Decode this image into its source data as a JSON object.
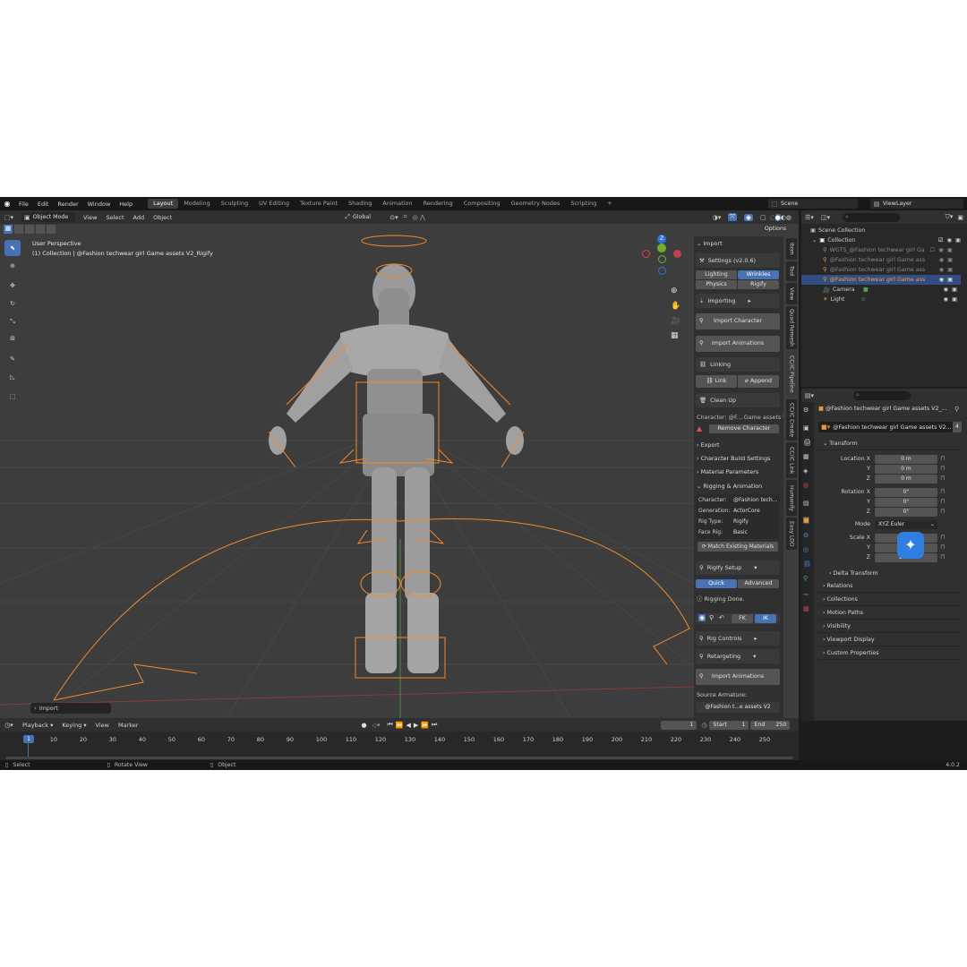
{
  "app": {
    "version": "4.0.2"
  },
  "colors": {
    "accent": "#4772b3",
    "selection": "#f08c2a",
    "bg": "#3d3d3d",
    "warn": "#e05050"
  },
  "topbar": {
    "menus": [
      "File",
      "Edit",
      "Render",
      "Window",
      "Help"
    ],
    "workspaces": [
      "Layout",
      "Modeling",
      "Sculpting",
      "UV Editing",
      "Texture Paint",
      "Shading",
      "Animation",
      "Rendering",
      "Compositing",
      "Geometry Nodes",
      "Scripting"
    ],
    "active_workspace": "Layout",
    "add_tab": "+",
    "scene": "Scene",
    "view_layer": "ViewLayer"
  },
  "viewport": {
    "mode": "Object Mode",
    "menus": [
      "View",
      "Select",
      "Add",
      "Object"
    ],
    "orientation": "Global",
    "options": "Options",
    "info_line1": "User Perspective",
    "info_line2": "(1) Collection | @Fashion techwear girl Game assets V2_Rigify",
    "gizmo_z": "Z",
    "last_op": "Import"
  },
  "npanel": {
    "import_header": "Import",
    "settings_label": "Settings  (v2.0.6)",
    "settings_tabs": [
      "Lighting",
      "Wrinkles",
      "Physics",
      "Rigify"
    ],
    "active_settings_tab": "Wrinkles",
    "importing": "Importing",
    "import_character": "Import Character",
    "import_animations": "Import Animations",
    "linking": "Linking",
    "link": "Link",
    "append": "Append",
    "clean_up": "Clean Up",
    "character_label": "Character: @F....Game assets V2",
    "remove_character": "Remove Character",
    "export": "Export",
    "character_build": "Character Build Settings",
    "material_params": "Material Parameters",
    "rigging_anim": "Rigging & Animation",
    "info": [
      {
        "k": "Character:",
        "v": "@Fashion tech..."
      },
      {
        "k": "Generation:",
        "v": "ActorCore"
      },
      {
        "k": "Rig Type:",
        "v": "Rigify"
      },
      {
        "k": "Face Rig:",
        "v": "Basic"
      }
    ],
    "match_materials": "Match Existing Materials",
    "rigify_setup": "Rigify Setup",
    "quick": "Quick",
    "advanced": "Advanced",
    "rigging_done": "Rigging Done.",
    "fk": "FK",
    "ik": "IK",
    "rig_controls": "Rig Controls",
    "retargeting": "Retargeting",
    "import_animations2": "Import Animations",
    "source_armature": "Source Armature:",
    "source_value": "@Fashion t...e assets V2"
  },
  "vtabs": [
    "Item",
    "Tool",
    "View",
    "Quad Remesh",
    "CC/iC Pipeline",
    "CC/iC Create",
    "CC/iC Link",
    "Humanify",
    "Easy LOD"
  ],
  "outliner": {
    "scene_collection": "Scene Collection",
    "collection": "Collection",
    "items": [
      {
        "label": "WGTS_@Fashion techwear girl Ga",
        "selected": false
      },
      {
        "label": "@Fashion techwear girl Game ass",
        "selected": false
      },
      {
        "label": "@Fashion techwear girl Game ass",
        "selected": false
      },
      {
        "label": "@Fashion techwear girl Game ass",
        "selected": true
      },
      {
        "label": "Camera",
        "selected": false
      },
      {
        "label": "Light",
        "selected": false
      }
    ]
  },
  "properties": {
    "object_path": "@Fashion techwear girl Game assets V2_...",
    "object_name": "@Fashion techwear girl Game assets V2...",
    "user_count": "4",
    "transform": "Transform",
    "location": {
      "labels": [
        "Location X",
        "Y",
        "Z"
      ],
      "values": [
        "0 m",
        "0 m",
        "0 m"
      ]
    },
    "rotation": {
      "labels": [
        "Rotation X",
        "Y",
        "Z"
      ],
      "values": [
        "0°",
        "0°",
        "0°"
      ]
    },
    "mode_label": "Mode",
    "mode_value": "XYZ Euler",
    "scale": {
      "labels": [
        "Scale X",
        "Y",
        "Z"
      ],
      "values": [
        "1.000",
        "1.000",
        "1.000"
      ]
    },
    "delta": "Delta Transform",
    "panels": [
      "Relations",
      "Collections",
      "Motion Paths",
      "Visibility",
      "Viewport Display",
      "Custom Properties"
    ]
  },
  "timeline": {
    "menus": [
      "Playback",
      "Keying",
      "View",
      "Marker"
    ],
    "current_frame": "1",
    "start_label": "Start",
    "start": "1",
    "end_label": "End",
    "end": "250",
    "ticks": [
      "10",
      "20",
      "30",
      "40",
      "50",
      "60",
      "70",
      "80",
      "90",
      "100",
      "110",
      "120",
      "130",
      "140",
      "150",
      "160",
      "170",
      "180",
      "190",
      "200",
      "210",
      "220",
      "230",
      "240",
      "250"
    ],
    "playhead": "1"
  },
  "statusbar": {
    "select": "Select",
    "rotate": "Rotate View",
    "object": "Object"
  }
}
